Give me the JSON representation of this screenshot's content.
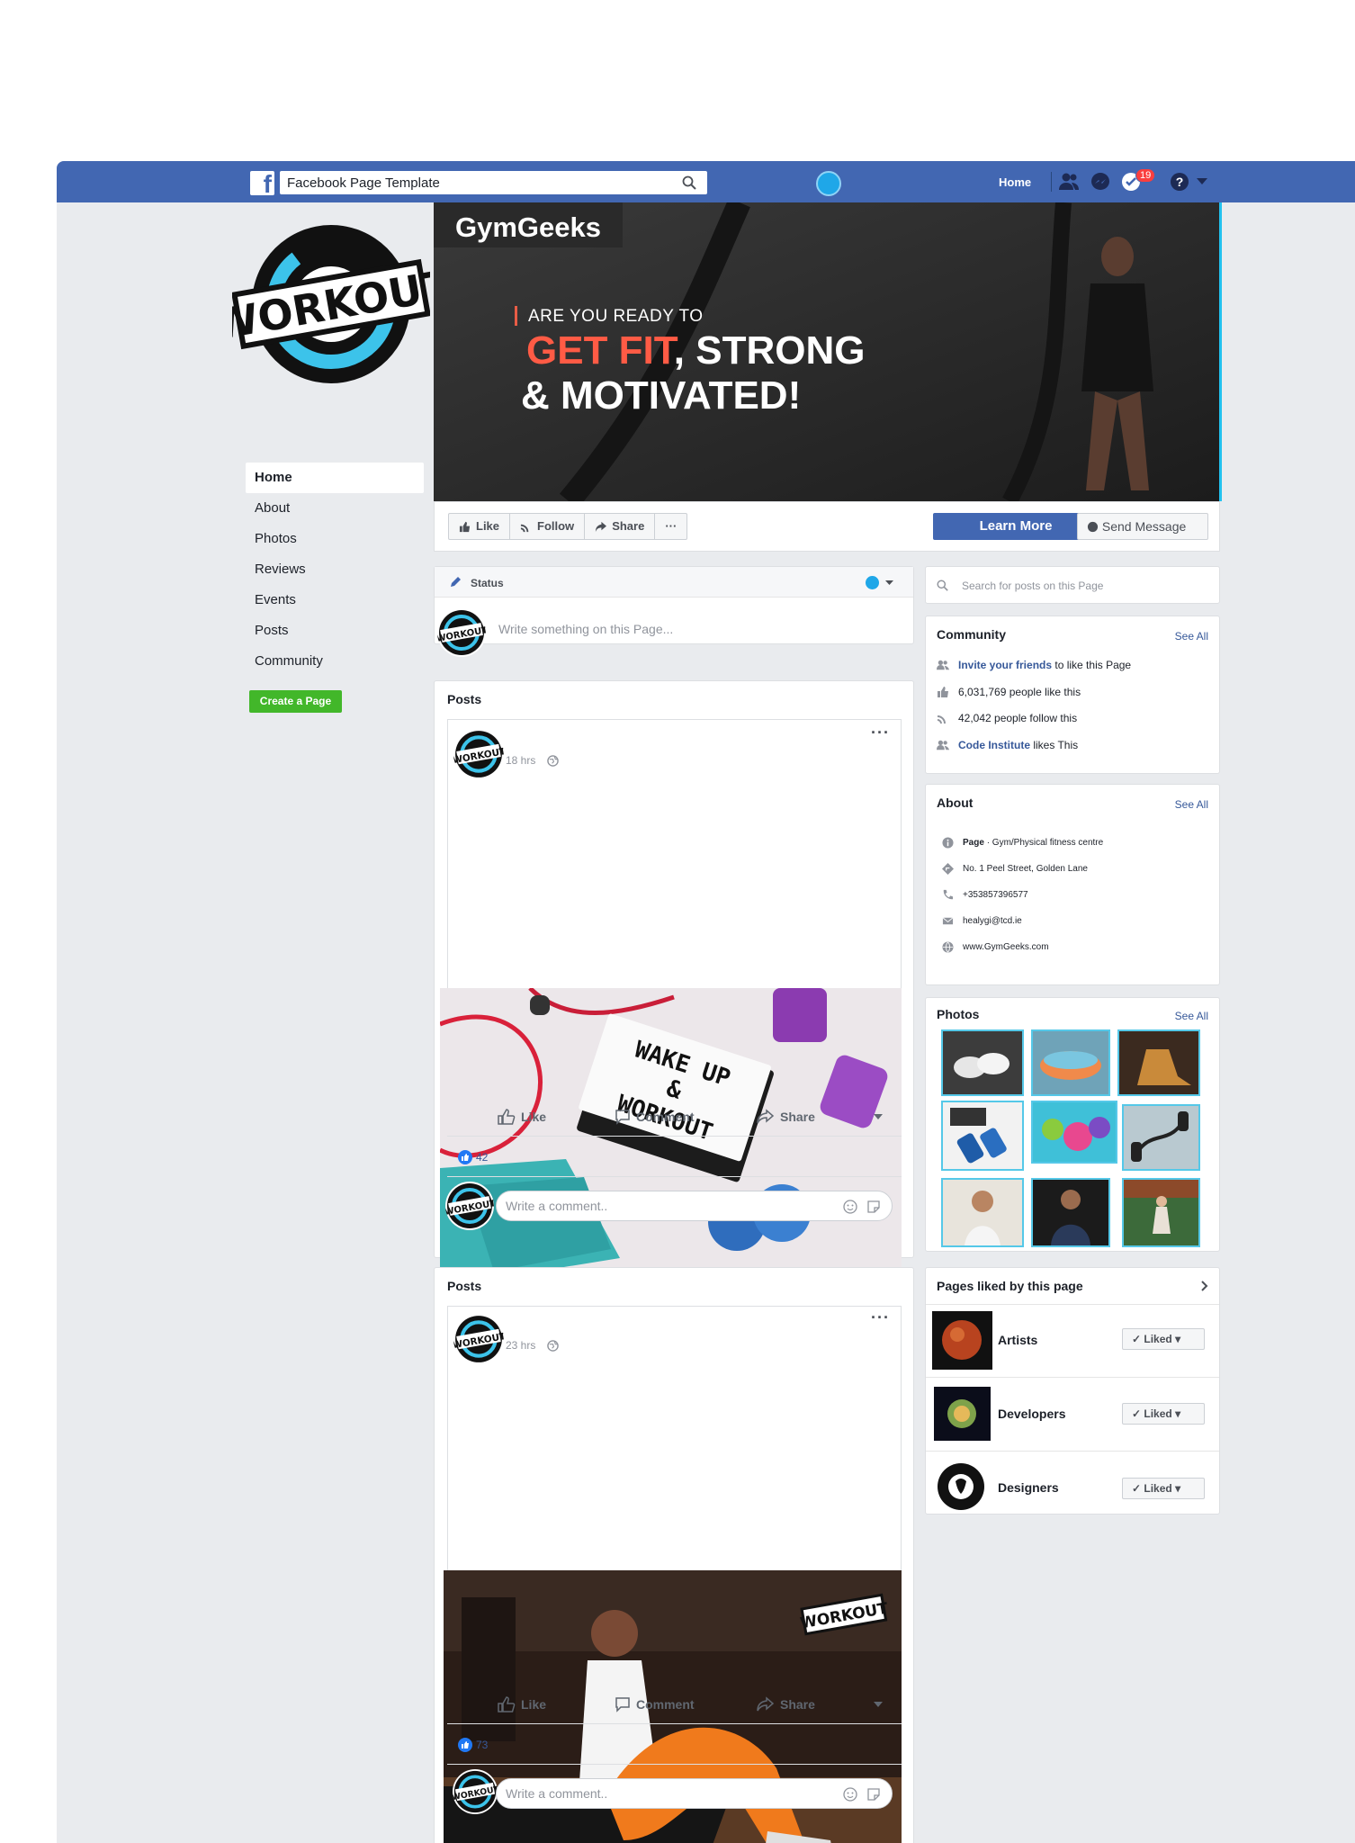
{
  "topbar": {
    "search_value": "Facebook Page Template",
    "home_label": "Home",
    "notification_count": "19",
    "brand_color": "#4267b2"
  },
  "page": {
    "nav": [
      "Home",
      "About",
      "Photos",
      "Reviews",
      "Events",
      "Posts",
      "Community"
    ],
    "create_page_label": "Create a Page",
    "logo_text": "WORKOUT"
  },
  "cover": {
    "title": "GymGeeks",
    "tagline_small": "ARE YOU READY TO",
    "tagline_accent": "GET FIT",
    "tagline_rest": ", STRONG",
    "tagline_line2": "& MOTIVATED!"
  },
  "actions": {
    "like": "Like",
    "follow": "Follow",
    "share": "Share",
    "more": "···",
    "learn_more": "Learn More",
    "send_message": "Send Message"
  },
  "status": {
    "label": "Status",
    "placeholder": "Write something on this Page..."
  },
  "posts": [
    {
      "section_title": "Posts",
      "time": "18 hrs",
      "image_text": "WAKE UP & WORKOUT",
      "like_label": "Like",
      "comment_label": "Comment",
      "share_label": "Share",
      "like_count": "42",
      "comment_placeholder": "Write a comment.."
    },
    {
      "section_title": "Posts",
      "time": "23 hrs",
      "image_text": "WORKOUT",
      "like_label": "Like",
      "comment_label": "Comment",
      "share_label": "Share",
      "like_count": "73",
      "comment_placeholder": "Write a comment.."
    }
  ],
  "sidebar": {
    "search_placeholder": "Search for posts on this Page",
    "community": {
      "title": "Community",
      "see_all": "See All",
      "invite_link": "Invite your friends",
      "invite_rest": "to like this Page",
      "likes": "6,031,769 people like this",
      "follows": "42,042 people follow this",
      "liker_link": "Code Institute",
      "liker_rest": "likes This"
    },
    "about": {
      "title": "About",
      "see_all": "See All",
      "page_label": "Page",
      "category": "· Gym/Physical fitness centre",
      "address": "No. 1 Peel Street, Golden Lane",
      "phone": "+353857396577",
      "email": "healygi@tcd.ie",
      "website": "www.GymGeeks.com"
    },
    "photos": {
      "title": "Photos",
      "see_all": "See All"
    },
    "liked_pages": {
      "title": "Pages liked by this page",
      "items": [
        {
          "name": "Artists",
          "button": "Liked"
        },
        {
          "name": "Developers",
          "button": "Liked"
        },
        {
          "name": "Designers",
          "button": "Liked"
        }
      ]
    }
  }
}
